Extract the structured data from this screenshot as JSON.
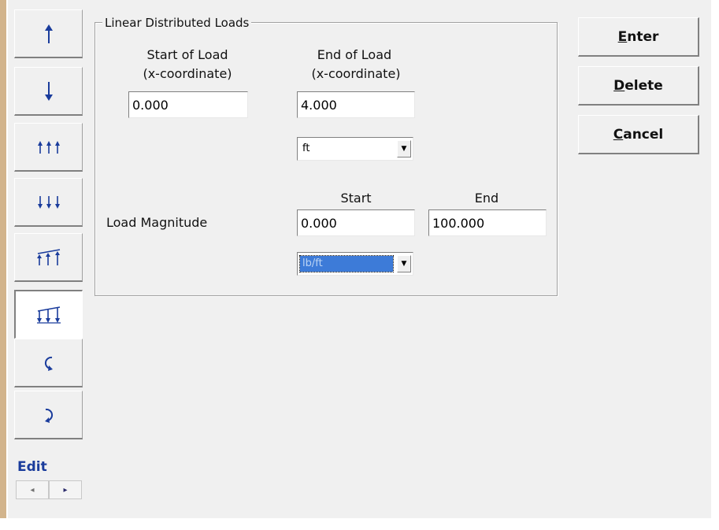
{
  "tool_buttons": [
    {
      "icon": "point-load-up-icon"
    },
    {
      "icon": "point-load-down-icon"
    },
    {
      "icon": "uniform-load-up-icon"
    },
    {
      "icon": "uniform-load-down-icon"
    },
    {
      "icon": "linear-load-up-icon"
    },
    {
      "icon": "linear-load-down-icon",
      "selected": true
    },
    {
      "icon": "moment-ccw-icon"
    },
    {
      "icon": "moment-cw-icon"
    }
  ],
  "edit": {
    "label": "Edit"
  },
  "group": {
    "title": "Linear Distributed Loads"
  },
  "start_of_load": {
    "line1": "Start of Load",
    "line2": "(x-coordinate)",
    "value": "0.000"
  },
  "end_of_load": {
    "line1": "End of Load",
    "line2": "(x-coordinate)",
    "value": "4.000"
  },
  "length_unit": {
    "selected": "ft"
  },
  "magnitude": {
    "label": "Load Magnitude",
    "start_header": "Start",
    "end_header": "End",
    "start_value": "0.000",
    "end_value": "100.000"
  },
  "force_unit": {
    "selected": "lb/ft"
  },
  "buttons": {
    "enter": {
      "mnemonic": "E",
      "rest": "nter"
    },
    "delete": {
      "mnemonic": "D",
      "rest": "elete"
    },
    "cancel": {
      "mnemonic": "C",
      "rest": "ancel"
    }
  },
  "colors": {
    "icon_blue": "#1a3c9c",
    "selection_blue": "#3d7bd8",
    "panel_gray": "#f0f0f0"
  }
}
